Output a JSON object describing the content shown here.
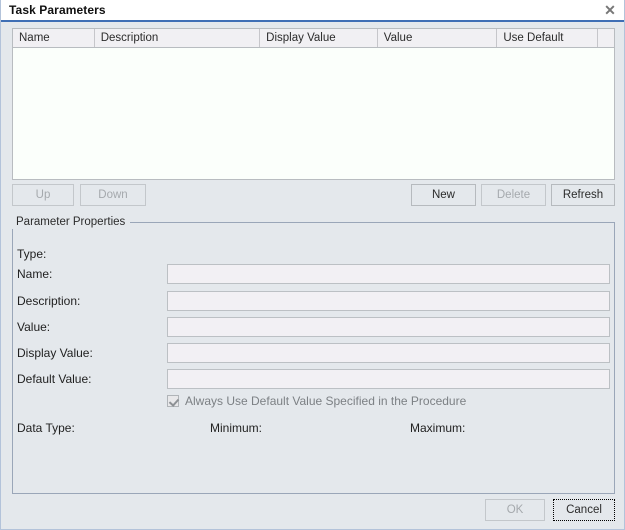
{
  "window": {
    "title": "Task Parameters",
    "close_icon": "close-icon",
    "close_glyph": "✕",
    "accent_color": "#3f6fb5",
    "background_color": "#e4e8ec",
    "border_color": "#b3c3da"
  },
  "table": {
    "columns": [
      {
        "label": "Name",
        "width": 82
      },
      {
        "label": "Description",
        "width": 166
      },
      {
        "label": "Display Value",
        "width": 118
      },
      {
        "label": "Value",
        "width": 120
      },
      {
        "label": "Use Default",
        "width": 101
      },
      {
        "label": "",
        "width": 16
      }
    ],
    "rows": [],
    "empty": true
  },
  "list_buttons": {
    "up": {
      "label": "Up",
      "enabled": false
    },
    "down": {
      "label": "Down",
      "enabled": false
    },
    "new": {
      "label": "New",
      "enabled": true
    },
    "delete": {
      "label": "Delete",
      "enabled": false
    },
    "refresh": {
      "label": "Refresh",
      "enabled": true
    }
  },
  "properties": {
    "legend": "Parameter Properties",
    "type": {
      "label": "Type:",
      "value": ""
    },
    "fields": [
      {
        "key": "name",
        "label": "Name:",
        "value": "",
        "placeholder": ""
      },
      {
        "key": "description",
        "label": "Description:",
        "value": "",
        "placeholder": ""
      },
      {
        "key": "value",
        "label": "Value:",
        "value": "",
        "placeholder": ""
      },
      {
        "key": "display_value",
        "label": "Display Value:",
        "value": "",
        "placeholder": ""
      },
      {
        "key": "default_value",
        "label": "Default Value:",
        "value": "",
        "placeholder": ""
      }
    ],
    "always_default": {
      "label": "Always Use Default Value Specified in the Procedure",
      "checked": true,
      "enabled": false
    },
    "data_type": {
      "label": "Data Type:",
      "value": ""
    },
    "minimum": {
      "label": "Minimum:",
      "value": ""
    },
    "maximum": {
      "label": "Maximum:",
      "value": ""
    }
  },
  "footer": {
    "ok": {
      "label": "OK",
      "enabled": false
    },
    "cancel": {
      "label": "Cancel",
      "enabled": true,
      "focused": true
    }
  }
}
